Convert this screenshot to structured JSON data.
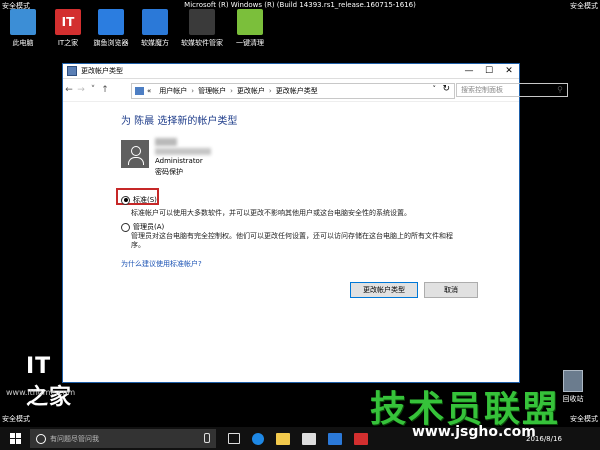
{
  "corners": {
    "top_left": "安全模式",
    "top_right": "安全模式",
    "bottom_left": "安全模式",
    "bottom_right": "安全模式"
  },
  "build_text": "Microsoft (R) Windows (R) (Build 14393.rs1_release.160715-1616)",
  "desktop_icons": [
    {
      "label": "此电脑",
      "color": "#3c8ed6",
      "glyph": ""
    },
    {
      "label": "IT之家",
      "color": "#d32f2f",
      "glyph": "IT"
    },
    {
      "label": "旗鱼浏览器",
      "color": "#2b7de0",
      "glyph": ""
    },
    {
      "label": "软媒魔方",
      "color": "#2b79d8",
      "glyph": ""
    },
    {
      "label": "软媒软件管家",
      "color": "#3a3a3a",
      "glyph": ""
    },
    {
      "label": "一键清理",
      "color": "#7bbf3b",
      "glyph": ""
    }
  ],
  "window": {
    "title": "更改帐户类型",
    "breadcrumbs": [
      "用户帐户",
      "管理帐户",
      "更改帐户",
      "更改帐户类型"
    ],
    "search_placeholder": "搜索控制面板",
    "heading": "为 陈晨 选择新的帐户类型",
    "account_role": "Administrator",
    "account_protection": "密码保护",
    "option_standard": "标准(S)",
    "option_standard_desc": "标准帐户可以使用大多数软件，并可以更改不影响其他用户或这台电脑安全性的系统设置。",
    "option_admin": "管理员(A)",
    "option_admin_desc_1": "管理员对这台电脑有完全控制权。他们可以更改任何设置，还可以访问存储在这台电脑上的所有文件和程",
    "option_admin_desc_2": "序。",
    "selected_option": "standard",
    "why_link": "为什么建议使用标准帐户?",
    "btn_change": "更改帐户类型",
    "btn_cancel": "取消"
  },
  "watermark": {
    "it_logo": "IT之家",
    "it_url": "www.ithome.com",
    "brand": "技术员联盟",
    "brand_url": "www.jsgho.com"
  },
  "recycle_bin": "回收站",
  "taskbar": {
    "search_placeholder": "有问题尽管问我",
    "date": "2016/8/16"
  }
}
